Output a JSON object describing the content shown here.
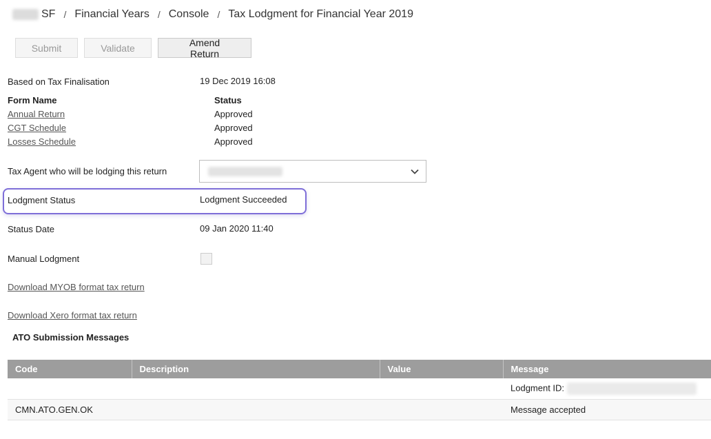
{
  "breadcrumb": {
    "fund_suffix": "SF",
    "items": [
      "Financial Years",
      "Console",
      "Tax Lodgment for Financial Year 2019"
    ],
    "separator": "/"
  },
  "toolbar": {
    "submit_label": "Submit",
    "validate_label": "Validate",
    "amend_label": "Amend Return"
  },
  "details": {
    "finalisation_label": "Based on Tax Finalisation",
    "finalisation_value": "19 Dec 2019 16:08",
    "form_name_header": "Form Name",
    "status_header": "Status",
    "forms": [
      {
        "name": "Annual Return",
        "status": "Approved"
      },
      {
        "name": "CGT Schedule",
        "status": "Approved"
      },
      {
        "name": "Losses Schedule",
        "status": "Approved"
      }
    ],
    "tax_agent_label": "Tax Agent who will be lodging this return",
    "lodgment_status_label": "Lodgment Status",
    "lodgment_status_value": "Lodgment Succeeded",
    "status_date_label": "Status Date",
    "status_date_value": "09 Jan 2020 11:40",
    "manual_lodgment_label": "Manual Lodgment",
    "manual_lodgment_checked": false,
    "download_myob": "Download MYOB format tax return",
    "download_xero": "Download Xero format tax return"
  },
  "messages": {
    "title": "ATO Submission Messages",
    "columns": [
      "Code",
      "Description",
      "Value",
      "Message"
    ],
    "rows": [
      {
        "code": "",
        "description": "",
        "value": "",
        "message": "Lodgment ID:"
      },
      {
        "code": "CMN.ATO.GEN.OK",
        "description": "",
        "value": "",
        "message": "Message accepted"
      }
    ]
  },
  "colors": {
    "highlight": "#7e6ed8",
    "table_header": "#9d9d9d"
  }
}
